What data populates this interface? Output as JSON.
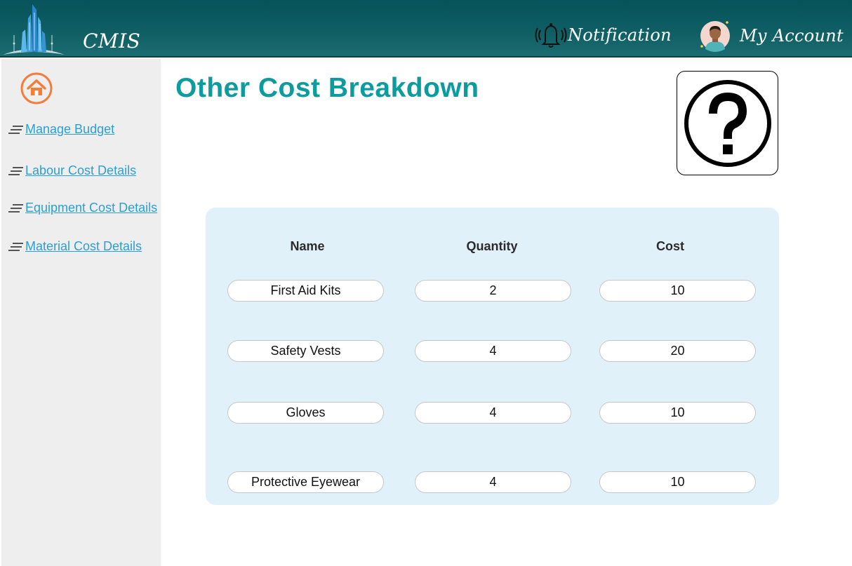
{
  "header": {
    "brand": "CMIS",
    "notification_label": "Notification",
    "account_label": "My Account"
  },
  "sidebar": {
    "items": [
      {
        "label": "Manage Budget",
        "icon": "menu-lines-icon"
      },
      {
        "label": "Labour Cost Details",
        "icon": "menu-lines-icon"
      },
      {
        "label": "Equipment Cost Details",
        "icon": "menu-lines-icon"
      },
      {
        "label": "Material Cost Details",
        "icon": "menu-lines-icon"
      }
    ]
  },
  "main": {
    "title": "Other Cost Breakdown",
    "help_icon": "question-mark-icon",
    "table": {
      "headers": [
        "Name",
        "Quantity",
        "Cost"
      ],
      "rows": [
        {
          "name": "First Aid Kits",
          "quantity": "2",
          "cost": "10"
        },
        {
          "name": "Safety Vests",
          "quantity": "4",
          "cost": "20"
        },
        {
          "name": "Gloves",
          "quantity": "4",
          "cost": "10"
        },
        {
          "name": "Protective Eyewear",
          "quantity": "4",
          "cost": "10"
        }
      ]
    }
  },
  "colors": {
    "header_bg": "#0e5e64",
    "title": "#0c9c9f",
    "link": "#2a9fd6",
    "home_accent": "#f47d3a",
    "card_bg": "#e1f1f9",
    "sidebar_bg": "#eeeeee"
  }
}
